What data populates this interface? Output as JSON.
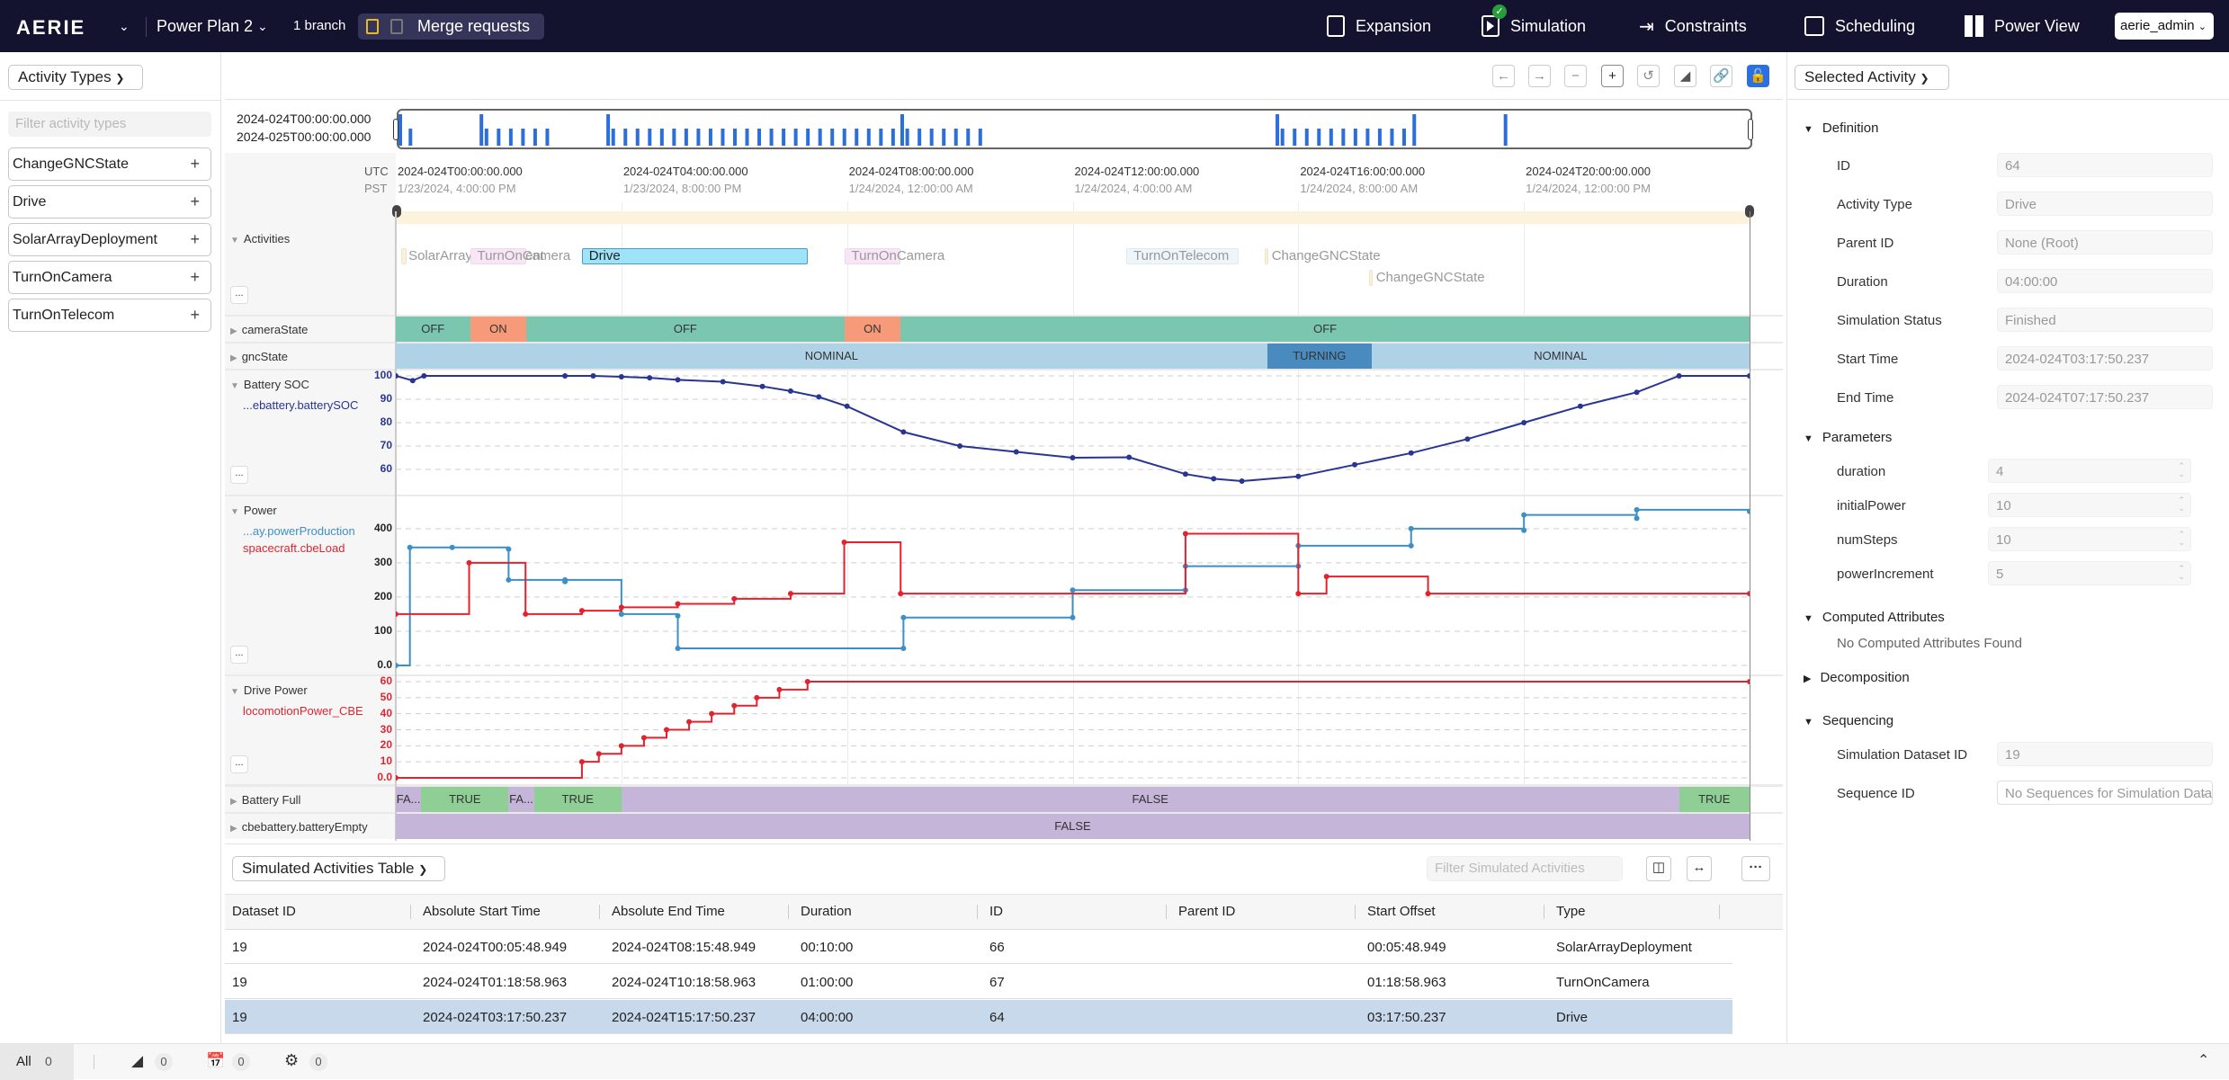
{
  "header": {
    "logo": "AERIE",
    "plan_name": "Power Plan 2",
    "branch_count": "1 branch",
    "merge_requests_label": "Merge requests",
    "nav": [
      {
        "label": "Expansion",
        "icon": "expansion-icon"
      },
      {
        "label": "Simulation",
        "icon": "simulation-icon",
        "status": "complete"
      },
      {
        "label": "Constraints",
        "icon": "constraints-icon"
      },
      {
        "label": "Scheduling",
        "icon": "scheduling-icon"
      },
      {
        "label": "Power View",
        "icon": "view-icon"
      }
    ],
    "user": "aerie_admin"
  },
  "left_panel": {
    "dropdown_label": "Activity Types",
    "filter_placeholder": "Filter activity types",
    "activity_types": [
      "ChangeGNCState",
      "Drive",
      "SolarArrayDeployment",
      "TurnOnCamera",
      "TurnOnTelecom"
    ]
  },
  "timeline": {
    "toolbar": [
      "nudge-left",
      "nudge-right",
      "zoom-out",
      "zoom-in",
      "reset",
      "toggle-hover",
      "link",
      "lock"
    ],
    "overview_start": "2024-024T00:00:00.000",
    "overview_end": "2024-025T00:00:00.000",
    "tz_primary": "UTC",
    "tz_secondary": "PST",
    "ticks": [
      {
        "utc": "2024-024T00:00:00.000",
        "local": "1/23/2024, 4:00:00 PM"
      },
      {
        "utc": "2024-024T04:00:00.000",
        "local": "1/23/2024, 8:00:00 PM"
      },
      {
        "utc": "2024-024T08:00:00.000",
        "local": "1/24/2024, 12:00:00 AM"
      },
      {
        "utc": "2024-024T12:00:00.000",
        "local": "1/24/2024, 4:00:00 AM"
      },
      {
        "utc": "2024-024T16:00:00.000",
        "local": "1/24/2024, 8:00:00 AM"
      },
      {
        "utc": "2024-024T20:00:00.000",
        "local": "1/24/2024, 12:00:00 PM"
      }
    ],
    "rows": {
      "activities": {
        "label": "Activities",
        "items": [
          {
            "name": "SolarArrayDeployment",
            "display": "SolarArrayDeployment",
            "start_h": 0.097,
            "dur_h": 0.1,
            "lane": 0,
            "color": "#fdf0d8"
          },
          {
            "name": "TurnOnCamera",
            "display": "TurnOnCamera",
            "start_h": 1.316,
            "dur_h": 1.0,
            "lane": 0,
            "color": "#f8e6f6"
          },
          {
            "name": "Drive",
            "display": "Drive",
            "start_h": 3.297,
            "dur_h": 4.0,
            "lane": 0,
            "color": "#9ee3f7",
            "selected": true
          },
          {
            "name": "TurnOnCamera",
            "display": "TurnOnCamera",
            "start_h": 7.95,
            "dur_h": 1.0,
            "lane": 0,
            "color": "#f8e6f6"
          },
          {
            "name": "TurnOnTelecom",
            "display": "TurnOnTelecom",
            "start_h": 12.95,
            "dur_h": 2.0,
            "lane": 0,
            "color": "#eef5fb"
          },
          {
            "name": "ChangeGNCState",
            "display": "ChangeGNCState",
            "start_h": 15.4,
            "dur_h": 0.05,
            "lane": 0,
            "color": "#fdf0d8"
          },
          {
            "name": "ChangeGNCState",
            "display": "ChangeGNCState",
            "start_h": 17.25,
            "dur_h": 0.05,
            "lane": 1,
            "color": "#fdf0d8"
          }
        ]
      },
      "cameraState": {
        "label": "cameraState",
        "segments": [
          {
            "start_h": 0,
            "end_h": 1.316,
            "value": "OFF"
          },
          {
            "start_h": 1.316,
            "end_h": 2.316,
            "value": "ON"
          },
          {
            "start_h": 2.316,
            "end_h": 7.95,
            "value": "OFF"
          },
          {
            "start_h": 7.95,
            "end_h": 8.95,
            "value": "ON"
          },
          {
            "start_h": 8.95,
            "end_h": 24,
            "value": "OFF"
          }
        ]
      },
      "gncState": {
        "label": "gncState",
        "segments": [
          {
            "start_h": 0,
            "end_h": 15.45,
            "value": "NOMINAL"
          },
          {
            "start_h": 15.45,
            "end_h": 17.3,
            "value": "TURNING"
          },
          {
            "start_h": 17.3,
            "end_h": 24,
            "value": "NOMINAL"
          }
        ]
      },
      "batteryFull": {
        "label": "Battery Full",
        "segments": [
          {
            "start_h": 0,
            "end_h": 0.45,
            "value": "FA..."
          },
          {
            "start_h": 0.45,
            "end_h": 2.0,
            "value": "TRUE"
          },
          {
            "start_h": 2.0,
            "end_h": 2.45,
            "value": "FA..."
          },
          {
            "start_h": 2.45,
            "end_h": 4.0,
            "value": "TRUE"
          },
          {
            "start_h": 4.0,
            "end_h": 22.75,
            "value": "FALSE"
          },
          {
            "start_h": 22.75,
            "end_h": 24,
            "value": "TRUE"
          }
        ]
      },
      "batteryEmpty": {
        "label": "cbebattery.batteryEmpty",
        "segments": [
          {
            "start_h": 0,
            "end_h": 24,
            "value": "FALSE"
          }
        ]
      }
    },
    "colors": {
      "off": "#7bc6ae",
      "on": "#f79a79",
      "nominal": "#b0d2e6",
      "turning": "#4a8bbf",
      "true": "#8fce94",
      "false": "#c5b5d8",
      "soc": "#283593",
      "production": "#3d8fc8",
      "load": "#e0242f"
    }
  },
  "chart_data": [
    {
      "type": "line",
      "title": "Battery SOC",
      "series": [
        {
          "name": "...ebattery.batterySOC",
          "x_hours": [
            0,
            0.3,
            0.5,
            3.0,
            3.5,
            4.0,
            4.5,
            5.0,
            5.8,
            6.5,
            7.0,
            7.5,
            8.0,
            9.0,
            10.0,
            11.0,
            12.0,
            13.0,
            14.0,
            14.5,
            15.0,
            16.0,
            17.0,
            18.0,
            19.0,
            20.0,
            21.0,
            22.0,
            22.75,
            24.0
          ],
          "y": [
            100,
            98,
            100,
            100,
            100,
            99.6,
            99.2,
            98.3,
            97.5,
            95.5,
            93.5,
            91,
            87,
            76,
            70,
            67.5,
            65,
            65.2,
            58,
            56,
            55,
            57,
            62,
            67,
            73,
            80,
            87,
            93,
            100,
            100
          ]
        }
      ],
      "yticks": [
        "100",
        "90",
        "80",
        "70",
        "60"
      ],
      "ylim": [
        55,
        100
      ]
    },
    {
      "type": "line",
      "title": "Power",
      "series": [
        {
          "name": "...ay.powerProduction",
          "step": true,
          "x_hours": [
            0,
            0.25,
            1.0,
            2.0,
            2.0,
            3.0,
            3.0,
            4.0,
            4.0,
            5.0,
            5.0,
            9.0,
            9.0,
            12.0,
            12.0,
            14.0,
            14.0,
            16.0,
            16.0,
            18.0,
            18.0,
            20.0,
            20.0,
            22.0,
            22.0,
            24.0
          ],
          "y": [
            0,
            345,
            345,
            340,
            250,
            245,
            250,
            150,
            150,
            145,
            50,
            50,
            140,
            140,
            220,
            220,
            290,
            290,
            350,
            350,
            400,
            395,
            440,
            430,
            455,
            450
          ]
        },
        {
          "name": "spacecraft.cbeLoad",
          "step": true,
          "x_hours": [
            0,
            1.3,
            2.3,
            3.3,
            4,
            5,
            6,
            7,
            7.95,
            8.95,
            14.0,
            16.0,
            16.5,
            18.3,
            24
          ],
          "y": [
            150,
            300,
            150,
            160,
            170,
            180,
            195,
            210,
            360,
            210,
            385,
            210,
            260,
            210,
            210
          ]
        }
      ],
      "yticks": [
        "400",
        "300",
        "200",
        "100",
        "0.0"
      ],
      "ylim": [
        0,
        460
      ]
    },
    {
      "type": "line",
      "title": "Drive Power",
      "series": [
        {
          "name": "locomotionPower_CBE",
          "step": true,
          "x_hours": [
            0,
            3.3,
            3.6,
            4.0,
            4.4,
            4.8,
            5.2,
            5.6,
            6.0,
            6.4,
            6.8,
            7.3,
            24
          ],
          "y": [
            0,
            10,
            15,
            20,
            25,
            30,
            35,
            40,
            45,
            50,
            55,
            60,
            60
          ]
        }
      ],
      "yticks": [
        "60",
        "50",
        "40",
        "30",
        "20",
        "10",
        "0.0"
      ],
      "ylim": [
        0,
        60
      ]
    }
  ],
  "right_panel": {
    "dropdown_label": "Selected Activity",
    "definition": {
      "title": "Definition",
      "fields": [
        {
          "label": "ID",
          "value": "64"
        },
        {
          "label": "Activity Type",
          "value": "Drive"
        },
        {
          "label": "Parent ID",
          "value": "None (Root)"
        },
        {
          "label": "Duration",
          "value": "04:00:00"
        },
        {
          "label": "Simulation Status",
          "value": "Finished"
        },
        {
          "label": "Start Time",
          "value": "2024-024T03:17:50.237"
        },
        {
          "label": "End Time",
          "value": "2024-024T07:17:50.237"
        }
      ]
    },
    "parameters": {
      "title": "Parameters",
      "fields": [
        {
          "label": "duration",
          "value": "4"
        },
        {
          "label": "initialPower",
          "value": "10"
        },
        {
          "label": "numSteps",
          "value": "10"
        },
        {
          "label": "powerIncrement",
          "value": "5"
        }
      ]
    },
    "computed": {
      "title": "Computed Attributes",
      "empty_text": "No Computed Attributes Found"
    },
    "decomposition": {
      "title": "Decomposition"
    },
    "sequencing": {
      "title": "Sequencing",
      "fields": [
        {
          "label": "Simulation Dataset ID",
          "value": "19"
        },
        {
          "label": "Sequence ID",
          "value": "No Sequences for Simulation Dataset"
        }
      ]
    }
  },
  "table": {
    "dropdown_label": "Simulated Activities Table",
    "filter_placeholder": "Filter Simulated Activities",
    "columns": [
      "Dataset ID",
      "Absolute Start Time",
      "Absolute End Time",
      "Duration",
      "ID",
      "Parent ID",
      "Start Offset",
      "Type"
    ],
    "rows": [
      [
        "19",
        "2024-024T00:05:48.949",
        "2024-024T08:15:48.949",
        "00:10:00",
        "66",
        "",
        "00:05:48.949",
        "SolarArrayDeployment"
      ],
      [
        "19",
        "2024-024T01:18:58.963",
        "2024-024T10:18:58.963",
        "01:00:00",
        "67",
        "",
        "01:18:58.963",
        "TurnOnCamera"
      ],
      [
        "19",
        "2024-024T03:17:50.237",
        "2024-024T15:17:50.237",
        "04:00:00",
        "64",
        "",
        "03:17:50.237",
        "Drive"
      ]
    ],
    "selected_row": 2
  },
  "footer": {
    "all_label": "All",
    "all_count": "0",
    "constraints_count": "0",
    "scheduling_count": "0",
    "simulation_count": "0"
  }
}
